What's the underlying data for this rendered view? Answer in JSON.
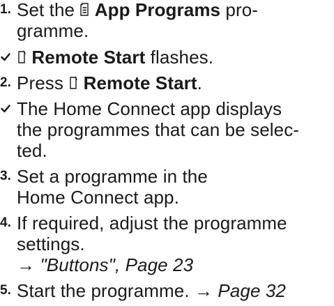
{
  "steps": [
    {
      "marker": "1.",
      "pre": "Set the ",
      "icon": "app-programs-icon",
      "bold": "App Programs",
      "post_line1": " pro-",
      "line2": "gramme."
    },
    {
      "marker": "check-icon",
      "icon": "remote-start-icon",
      "bold": "Remote Start",
      "post": " flashes."
    },
    {
      "marker": "2.",
      "pre": "Press ",
      "icon": "remote-start-icon",
      "bold": "Remote Start",
      "post": "."
    },
    {
      "marker": "check-icon",
      "line1": "The Home Connect app displays",
      "line2": "the programmes that can be selec-",
      "line3": "ted."
    },
    {
      "marker": "3.",
      "line1": "Set a programme in the",
      "line2": "Home Connect app."
    },
    {
      "marker": "4.",
      "line1": "If required, adjust the programme",
      "line2": "settings.",
      "ref_arrow": "→ ",
      "ref_text": "\"Buttons\", Page 23"
    },
    {
      "marker": "5.",
      "text": "Start the programme. ",
      "ref_arrow": "→ ",
      "ref_text": "Page 32"
    }
  ]
}
